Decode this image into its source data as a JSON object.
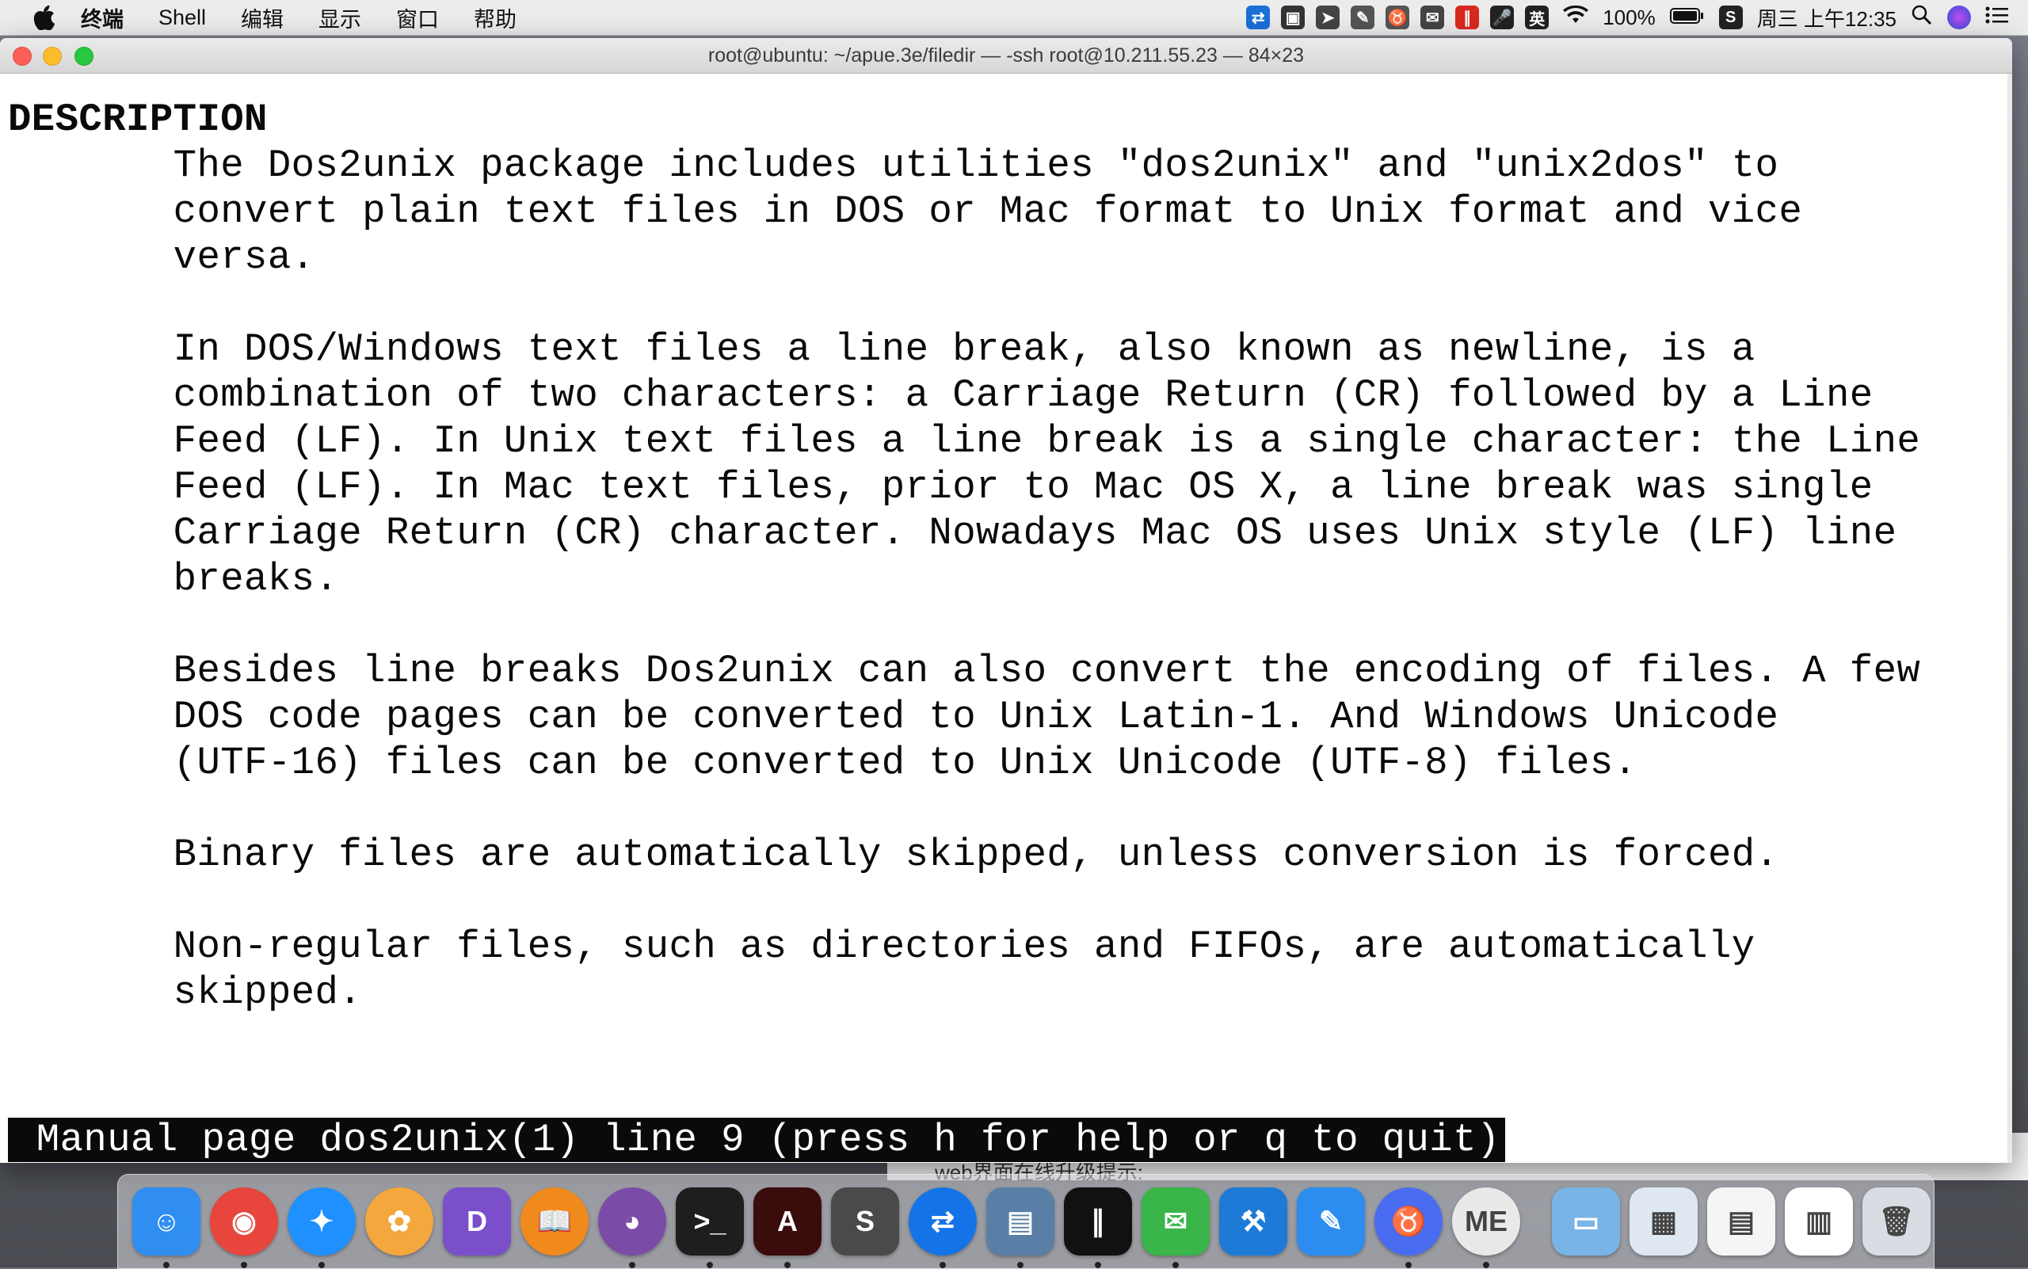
{
  "menubar": {
    "app_name": "终端",
    "items": [
      "Shell",
      "编辑",
      "显示",
      "窗口",
      "帮助"
    ],
    "battery": "100%",
    "clock": "周三 上午12:35",
    "status_icons": [
      {
        "name": "teamviewer-icon",
        "color": "#1a6fd8",
        "glyph": "⇄"
      },
      {
        "name": "notes-icon",
        "color": "#333333",
        "glyph": "▣"
      },
      {
        "name": "send-icon",
        "color": "#444444",
        "glyph": "➤"
      },
      {
        "name": "pen-icon",
        "color": "#555555",
        "glyph": "✎"
      },
      {
        "name": "taurus-icon",
        "color": "#555555",
        "glyph": "♉"
      },
      {
        "name": "wechat-icon",
        "color": "#444444",
        "glyph": "✉"
      },
      {
        "name": "parallels-icon",
        "color": "#d9281e",
        "glyph": "∥"
      },
      {
        "name": "mic-icon",
        "color": "#222222",
        "glyph": "🎤"
      },
      {
        "name": "input-method-icon",
        "color": "#222222",
        "glyph": "英"
      }
    ]
  },
  "window": {
    "title": "root@ubuntu: ~/apue.3e/filedir — -ssh root@10.211.55.23 — 84×23"
  },
  "terminal": {
    "lines": [
      {
        "row": 1,
        "text": "DESCRIPTION",
        "heading": true
      },
      {
        "row": 2,
        "text": "       The Dos2unix package includes utilities \"dos2unix\" and \"unix2dos\" to"
      },
      {
        "row": 3,
        "text": "       convert plain text files in DOS or Mac format to Unix format and vice"
      },
      {
        "row": 4,
        "text": "       versa."
      },
      {
        "row": 6,
        "text": "       In DOS/Windows text files a line break, also known as newline, is a"
      },
      {
        "row": 7,
        "text": "       combination of two characters: a Carriage Return (CR) followed by a Line"
      },
      {
        "row": 8,
        "text": "       Feed (LF). In Unix text files a line break is a single character: the Line"
      },
      {
        "row": 9,
        "text": "       Feed (LF). In Mac text files, prior to Mac OS X, a line break was single"
      },
      {
        "row": 10,
        "text": "       Carriage Return (CR) character. Nowadays Mac OS uses Unix style (LF) line"
      },
      {
        "row": 11,
        "text": "       breaks."
      },
      {
        "row": 13,
        "text": "       Besides line breaks Dos2unix can also convert the encoding of files. A few"
      },
      {
        "row": 14,
        "text": "       DOS code pages can be converted to Unix Latin-1. And Windows Unicode"
      },
      {
        "row": 15,
        "text": "       (UTF-16) files can be converted to Unix Unicode (UTF-8) files."
      },
      {
        "row": 17,
        "text": "       Binary files are automatically skipped, unless conversion is forced."
      },
      {
        "row": 19,
        "text": "       Non-regular files, such as directories and FIFOs, are automatically"
      },
      {
        "row": 20,
        "text": "       skipped."
      }
    ],
    "status": " Manual page dos2unix(1) line 9 (press h for help or q to quit)"
  },
  "background_window": {
    "text": "web界面在线升级提示:"
  },
  "dock": {
    "items": [
      {
        "name": "finder-icon",
        "color": "#2f8ef0",
        "glyph": "☺",
        "running": true
      },
      {
        "name": "chrome-icon",
        "color": "#e8453c",
        "glyph": "◉",
        "running": true,
        "circle": true
      },
      {
        "name": "safari-icon",
        "color": "#1e90ff",
        "glyph": "✦",
        "running": true,
        "circle": true
      },
      {
        "name": "photos-icon",
        "color": "#f4a73c",
        "glyph": "✿",
        "running": false,
        "circle": true
      },
      {
        "name": "dash-icon",
        "color": "#7a4fc9",
        "glyph": "D",
        "running": false
      },
      {
        "name": "books-icon",
        "color": "#f08a1d",
        "glyph": "📖",
        "running": false,
        "circle": true
      },
      {
        "name": "github-icon",
        "color": "#7b4ba8",
        "glyph": "◕",
        "running": true,
        "circle": true
      },
      {
        "name": "terminal-icon",
        "color": "#1e1e1e",
        "glyph": ">_",
        "running": true
      },
      {
        "name": "acrobat-icon",
        "color": "#3a0c0c",
        "glyph": "A",
        "running": true
      },
      {
        "name": "sublime-icon",
        "color": "#4a4a4a",
        "glyph": "S",
        "running": false
      },
      {
        "name": "teamviewer-dock-icon",
        "color": "#1473e6",
        "glyph": "⇄",
        "running": true,
        "circle": true
      },
      {
        "name": "parallels-dock-icon",
        "color": "#5a7fa6",
        "glyph": "▤",
        "running": true
      },
      {
        "name": "windows-vm-icon",
        "color": "#111111",
        "glyph": "∥",
        "running": true
      },
      {
        "name": "wechat-dock-icon",
        "color": "#39b54a",
        "glyph": "✉",
        "running": true
      },
      {
        "name": "xcode-icon",
        "color": "#1d7ad6",
        "glyph": "⚒",
        "running": false
      },
      {
        "name": "edit-icon",
        "color": "#2d8cf0",
        "glyph": "✎",
        "running": false
      },
      {
        "name": "taurus-dock-icon",
        "color": "#4a6cf0",
        "glyph": "♉",
        "running": true,
        "circle": true
      },
      {
        "name": "me-icon",
        "color": "#e9e9e9",
        "glyph": "ME",
        "running": true,
        "circle": true
      }
    ],
    "right_items": [
      {
        "name": "folder-icon",
        "color": "#79b4e6",
        "glyph": "▭"
      },
      {
        "name": "window-thumb-1-icon",
        "color": "#dfe8f2",
        "glyph": "▦"
      },
      {
        "name": "window-thumb-2-icon",
        "color": "#f5f5f5",
        "glyph": "▤"
      },
      {
        "name": "window-thumb-3-icon",
        "color": "#ffffff",
        "glyph": "▥"
      },
      {
        "name": "trash-icon",
        "color": "#d9dde3",
        "glyph": "🗑"
      }
    ]
  }
}
